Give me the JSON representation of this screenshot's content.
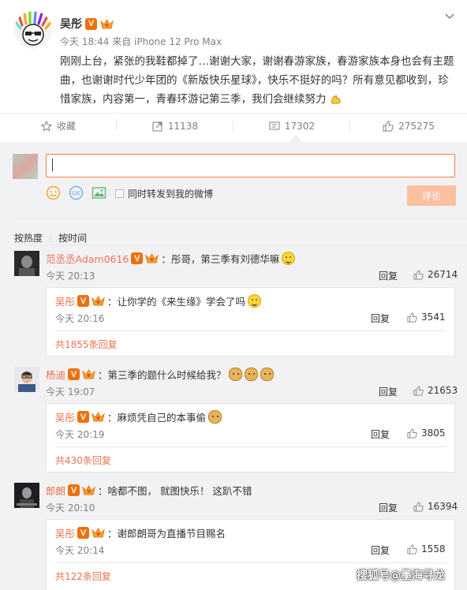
{
  "post": {
    "author": "吴彤",
    "verified": "V",
    "meta": "今天 18:44 来自 iPhone 12 Pro Max",
    "content": "刚刚上台，紧张的我鞋都掉了…谢谢大家，谢谢春游家族，春游家族本身也会有主题曲，也谢谢时代少年团的《新版快乐星球》，快乐不挺好的吗？所有意见都收到，珍惜家族，内容第一，青春环游记第三季，我们会继续努力"
  },
  "actions": {
    "favorite": "收藏",
    "forward": "11138",
    "comment": "17302",
    "like": "275275"
  },
  "composer": {
    "placeholder": "",
    "forward_label": "同时转发到我的微博",
    "submit_label": "评论"
  },
  "sort": {
    "hot": "按热度",
    "time": "按时间"
  },
  "comments": [
    {
      "name": "范丞丞Adam0616",
      "text": "：彤哥，第三季有刘德华嘛",
      "time": "今天 20:13",
      "reply": "回复",
      "likes": "26714",
      "sub": {
        "name": "吴彤",
        "text": "：让你学的《来生缘》学会了吗",
        "time": "今天 20:16",
        "reply": "回复",
        "likes": "3541"
      },
      "more": "共1855条回复"
    },
    {
      "name": "杨迪",
      "text": "：第三季的题什么时候给我？",
      "time": "今天 19:07",
      "reply": "回复",
      "likes": "21653",
      "sub": {
        "name": "吴彤",
        "text": "：麻烦凭自己的本事偷",
        "time": "今天 20:19",
        "reply": "回复",
        "likes": "3805"
      },
      "more": "共430条回复"
    },
    {
      "name": "郎朗",
      "text": "：啥都不图， 就图快乐！ 这趴不错",
      "time": "今天 20:10",
      "reply": "回复",
      "likes": "16394",
      "sub": {
        "name": "吴彤",
        "text": "：谢郎朗哥为直播节目赐名",
        "time": "今天 20:14",
        "reply": "回复",
        "likes": "1558"
      },
      "more": "共122条回复"
    }
  ],
  "watermark": "搜狐号@墨海寻龙",
  "colors": {
    "accent": "#eb7350",
    "verified": "#f06f0c",
    "submit": "#fbc0a0",
    "panel": "#f2f2f5"
  }
}
